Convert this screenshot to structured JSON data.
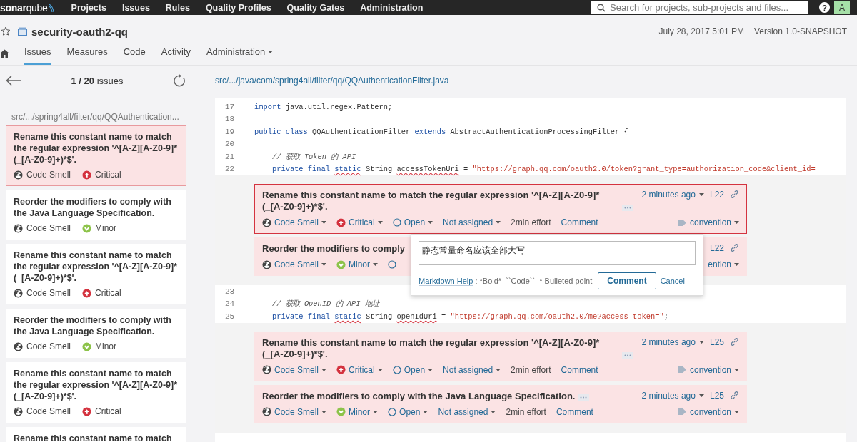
{
  "topbar": {
    "logo": "**sonar**qube",
    "nav": [
      "Projects",
      "Issues",
      "Rules",
      "Quality Profiles",
      "Quality Gates",
      "Administration"
    ],
    "search": {
      "placeholder": "Search for projects, sub-projects and files..."
    },
    "help": "?",
    "avatar": "A"
  },
  "project": {
    "name": "security-oauth2-qq",
    "starred": false,
    "date": "July 28, 2017 5:01 PM",
    "version": "Version 1.0-SNAPSHOT"
  },
  "tabs": [
    {
      "label": "Issues",
      "selected": true,
      "dropdown": false
    },
    {
      "label": "Measures",
      "selected": false,
      "dropdown": false
    },
    {
      "label": "Code",
      "selected": false,
      "dropdown": false
    },
    {
      "label": "Activity",
      "selected": false,
      "dropdown": false
    },
    {
      "label": "Administration",
      "selected": false,
      "dropdown": true
    }
  ],
  "sidebar": {
    "counter": "**1 / 20** issues",
    "file": "src/.../spring4all/filter/qq/QQAuthentication...",
    "issues": [
      {
        "message": "Rename this constant name to match the regular expression '^[A-Z][A-Z0-9]*(_[A-Z0-9]+)*$'.",
        "type": "Code Smell",
        "severity": {
          "label": "Critical",
          "kind": "critical"
        },
        "selected": true
      },
      {
        "message": "Reorder the modifiers to comply with the Java Language Specification.",
        "type": "Code Smell",
        "severity": {
          "label": "Minor",
          "kind": "minor"
        },
        "selected": false
      },
      {
        "message": "Rename this constant name to match the regular expression '^[A-Z][A-Z0-9]*(_[A-Z0-9]+)*$'.",
        "type": "Code Smell",
        "severity": {
          "label": "Critical",
          "kind": "critical"
        },
        "selected": false
      },
      {
        "message": "Reorder the modifiers to comply with the Java Language Specification.",
        "type": "Code Smell",
        "severity": {
          "label": "Minor",
          "kind": "minor"
        },
        "selected": false
      },
      {
        "message": "Rename this constant name to match the regular expression '^[A-Z][A-Z0-9]*(_[A-Z0-9]+)*$'.",
        "type": "Code Smell",
        "severity": {
          "label": "Critical",
          "kind": "critical"
        },
        "selected": false
      },
      {
        "message": "Rename this constant name to match",
        "selected": false
      }
    ]
  },
  "code": {
    "file": "src/.../java/com/spring4all/filter/qq/QQAuthenticationFilter.java",
    "blocks": [
      {
        "kind": "line",
        "number": "17",
        "tokens": [
          {
            "kind": "keyword",
            "text": "import"
          },
          {
            "kind": "plain",
            "text": " java.util.regex.Pattern;"
          }
        ]
      },
      {
        "kind": "line",
        "number": "18"
      },
      {
        "kind": "line",
        "number": "19",
        "tokens": [
          {
            "kind": "keyword",
            "text": "public class"
          },
          {
            "kind": "plain",
            "text": " QQAuthenticationFilter "
          },
          {
            "kind": "keyword",
            "text": "extends"
          },
          {
            "kind": "plain",
            "text": " AbstractAuthenticationProcessingFilter {"
          }
        ]
      },
      {
        "kind": "line",
        "number": "20"
      },
      {
        "kind": "line",
        "number": "21",
        "tokens": [
          {
            "kind": "comment",
            "text": "    // 获取 Token 的 API"
          }
        ]
      },
      {
        "kind": "line",
        "number": "22",
        "tokens": [
          {
            "kind": "keyword",
            "text": "    private final "
          },
          {
            "kind": "keyword",
            "text": "static",
            "flagged": true
          },
          {
            "kind": "plain",
            "text": " String "
          },
          {
            "kind": "plain",
            "text": "accessTokenUri",
            "flagged": true
          },
          {
            "kind": "plain",
            "text": " = "
          },
          {
            "kind": "string",
            "text": "\"https://graph.qq.com/oauth2.0/token?grant_type=authorization_code&client_id="
          }
        ]
      },
      {
        "kind": "issue",
        "message": "Rename this constant name to match the regular expression '^[A-Z][A-Z0-9]*(_[A-Z0-9]+)*$'.",
        "age": "2 minutes ago",
        "line": "L22",
        "type": "Code Smell",
        "severity": {
          "label": "Critical",
          "kind": "critical"
        },
        "status": "Open",
        "assignee": "Not assigned",
        "effort": "2min effort",
        "comment": "Comment",
        "tag": "convention",
        "selected": true,
        "popup": {
          "value": "静态常量命名应该全部大写",
          "help_link": "Markdown Help",
          "help_text": ": *Bold*  ``Code``  * Bulleted point",
          "submit": "Comment",
          "cancel": "Cancel"
        }
      },
      {
        "kind": "issue",
        "message": "Reorder the modifiers to comply",
        "line": "L22",
        "type": "Code Smell",
        "severity": {
          "label": "Minor",
          "kind": "minor"
        },
        "tag": "ention",
        "selected": false
      },
      {
        "kind": "line",
        "number": "23"
      },
      {
        "kind": "line",
        "number": "24",
        "tokens": [
          {
            "kind": "comment",
            "text": "    // 获取 OpenID 的 API 地址"
          }
        ]
      },
      {
        "kind": "line",
        "number": "25",
        "tokens": [
          {
            "kind": "keyword",
            "text": "    private final "
          },
          {
            "kind": "keyword",
            "text": "static",
            "flagged": true
          },
          {
            "kind": "plain",
            "text": " String "
          },
          {
            "kind": "plain",
            "text": "openIdUri",
            "flagged": true
          },
          {
            "kind": "plain",
            "text": " = "
          },
          {
            "kind": "string",
            "text": "\"https://graph.qq.com/oauth2.0/me?access_token=\""
          },
          {
            "kind": "plain",
            "text": ";"
          }
        ]
      },
      {
        "kind": "issue",
        "message": "Rename this constant name to match the regular expression '^[A-Z][A-Z0-9]*(_[A-Z0-9]+)*$'.",
        "age": "2 minutes ago",
        "line": "L25",
        "type": "Code Smell",
        "severity": {
          "label": "Critical",
          "kind": "critical"
        },
        "status": "Open",
        "assignee": "Not assigned",
        "effort": "2min effort",
        "comment": "Comment",
        "tag": "convention",
        "selected": false
      },
      {
        "kind": "issue",
        "message": "Reorder the modifiers to comply with the Java Language Specification.",
        "age": "2 minutes ago",
        "line": "L25",
        "type": "Code Smell",
        "severity": {
          "label": "Minor",
          "kind": "minor"
        },
        "status": "Open",
        "assignee": "Not assigned",
        "effort": "2min effort",
        "comment": "Comment",
        "tag": "convention",
        "selected": false
      }
    ]
  }
}
